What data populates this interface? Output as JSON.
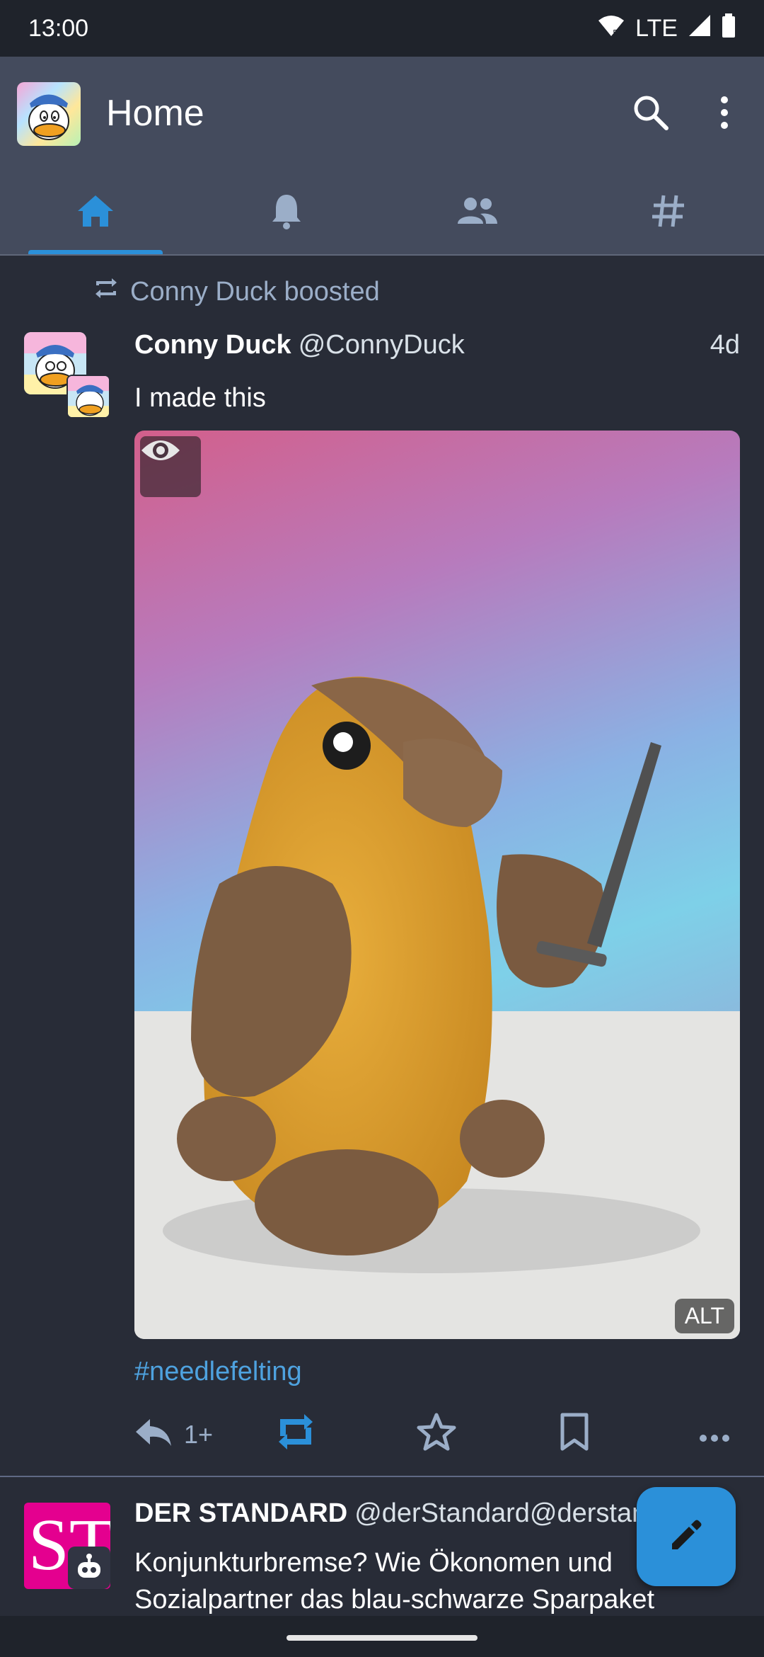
{
  "status_bar": {
    "time": "13:00",
    "network": "LTE"
  },
  "app_bar": {
    "title": "Home",
    "tabs": [
      {
        "name": "home",
        "icon": "home-icon",
        "active": true
      },
      {
        "name": "notifications",
        "icon": "bell-icon",
        "active": false
      },
      {
        "name": "local",
        "icon": "people-icon",
        "active": false
      },
      {
        "name": "hashtags",
        "icon": "hashtag-icon",
        "active": false
      }
    ],
    "accent_color": "#2b90d9"
  },
  "post": {
    "boost_label": "Conny Duck boosted",
    "display_name": "Conny Duck",
    "username": "@ConnyDuck",
    "time": "4d",
    "text": "I made this",
    "media_alt_badge": "ALT",
    "hashtag": "#needlefelting",
    "reply_count": "1+"
  },
  "post2": {
    "display_name": "DER STANDARD",
    "username": "@derStandard@derstandard.at",
    "logo_text": "ST",
    "text": "Konjunkturbremse? Wie Ökonomen und Sozialpartner das blau-schwarze Sparpaket"
  }
}
